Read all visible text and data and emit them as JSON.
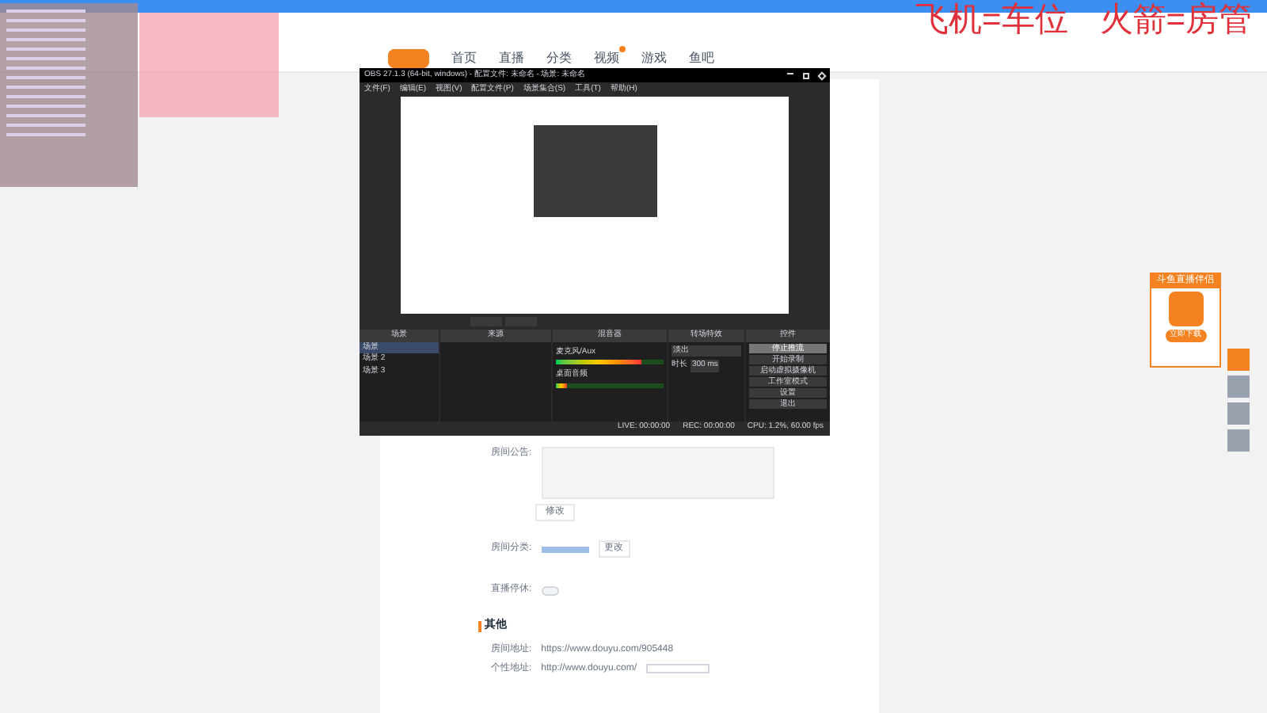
{
  "overlay_text": [
    "飞机=车位",
    "火箭=房管"
  ],
  "site_nav": {
    "items": [
      {
        "label": "首页",
        "badge": false
      },
      {
        "label": "直播",
        "badge": false
      },
      {
        "label": "分类",
        "badge": false
      },
      {
        "label": "视频",
        "badge": true
      },
      {
        "label": "游戏",
        "badge": false
      },
      {
        "label": "鱼吧",
        "badge": false
      }
    ]
  },
  "obs": {
    "title": "OBS 27.1.3 (64-bit, windows) - 配置文件: 未命名 - 场景: 未命名",
    "menu": [
      "文件(F)",
      "编辑(E)",
      "视图(V)",
      "配置文件(P)",
      "场景集合(S)",
      "工具(T)",
      "帮助(H)"
    ],
    "docks": [
      "场景",
      "来源",
      "混音器",
      "转场特效",
      "控件"
    ],
    "scenes": [
      {
        "label": "场景",
        "selected": true
      },
      {
        "label": "场景 2",
        "selected": false
      },
      {
        "label": "场景 3",
        "selected": false
      }
    ],
    "mixer": [
      {
        "name": "麦克风/Aux",
        "level": 0.8
      },
      {
        "name": "桌面音频",
        "level": 0.1
      }
    ],
    "transition": {
      "value": "淡出",
      "duration_label": "时长",
      "duration": "300 ms"
    },
    "controls": [
      {
        "label": "停止推流",
        "selected": true
      },
      {
        "label": "开始录制",
        "selected": false
      },
      {
        "label": "启动虚拟摄像机",
        "selected": false
      },
      {
        "label": "工作室模式",
        "selected": false
      },
      {
        "label": "设置",
        "selected": false
      },
      {
        "label": "退出",
        "selected": false
      }
    ],
    "status": [
      "LIVE: 00:00:00",
      "REC: 00:00:00",
      "CPU: 1.2%, 60.00 fps"
    ]
  },
  "form": {
    "notice_label": "房间公告:",
    "notice_button": "修改",
    "category_label": "房间分类:",
    "category_button": "更改",
    "toggle_label": "直播停休:",
    "toggle_on": false,
    "section_title": "其他",
    "room_url_label": "房间地址:",
    "room_url": "https://www.douyu.com/905448",
    "custom_url_label": "个性地址:",
    "custom_url_prefix": "http://www.douyu.com/"
  },
  "promo": {
    "title": "斗鱼直播伴侣",
    "button": "立即下载"
  }
}
